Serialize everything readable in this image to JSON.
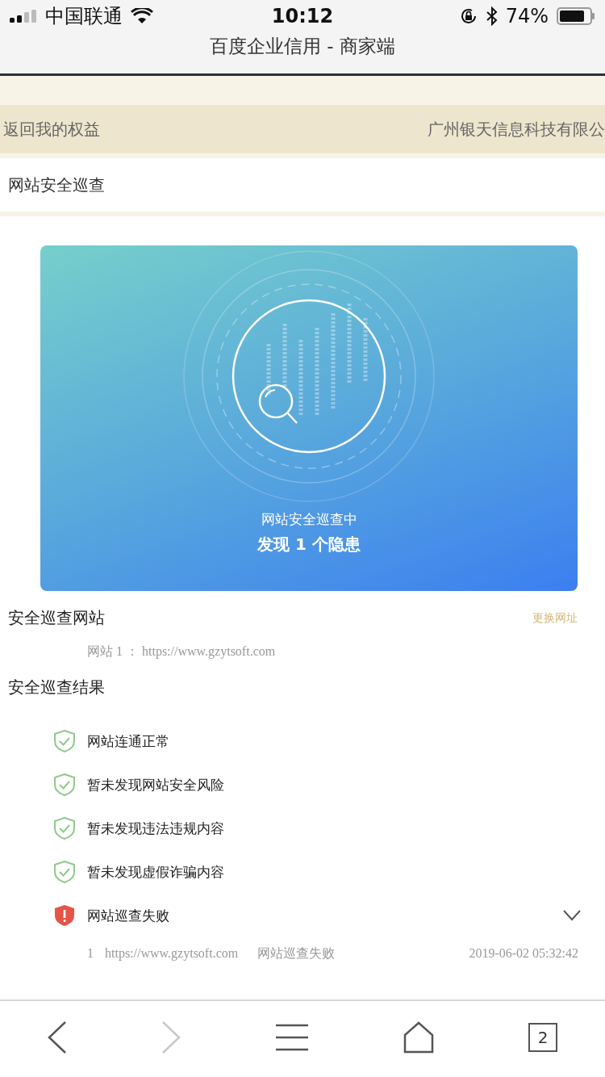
{
  "status_bar": {
    "carrier": "中国联通",
    "time": "10:12",
    "battery": "74%"
  },
  "browser": {
    "title": "百度企业信用 - 商家端"
  },
  "nav": {
    "back_label": "返回我的权益",
    "company": "广州银天信息科技有限公"
  },
  "page_title": "网站安全巡查",
  "hero": {
    "caption": "网站安全巡查中",
    "headline": "发现 1 个隐患"
  },
  "site_section": {
    "title": "安全巡查网站",
    "action": "更换网址",
    "site_label": "网站 1 ：",
    "site_url": "https://www.gzytsoft.com"
  },
  "results_section": {
    "title": "安全巡查结果",
    "items": [
      {
        "kind": "ok",
        "label": "网站连通正常"
      },
      {
        "kind": "ok",
        "label": "暂未发现网站安全风险"
      },
      {
        "kind": "ok",
        "label": "暂未发现违法违规内容"
      },
      {
        "kind": "ok",
        "label": "暂未发现虚假诈骗内容"
      },
      {
        "kind": "fail",
        "label": "网站巡查失败",
        "expanded": true,
        "details": [
          {
            "index": "1",
            "url": "https://www.gzytsoft.com",
            "status": "网站巡查失败",
            "time": "2019-06-02 05:32:42"
          }
        ]
      }
    ]
  },
  "toolbar": {
    "forward_disabled": true,
    "tab_count": "2"
  }
}
